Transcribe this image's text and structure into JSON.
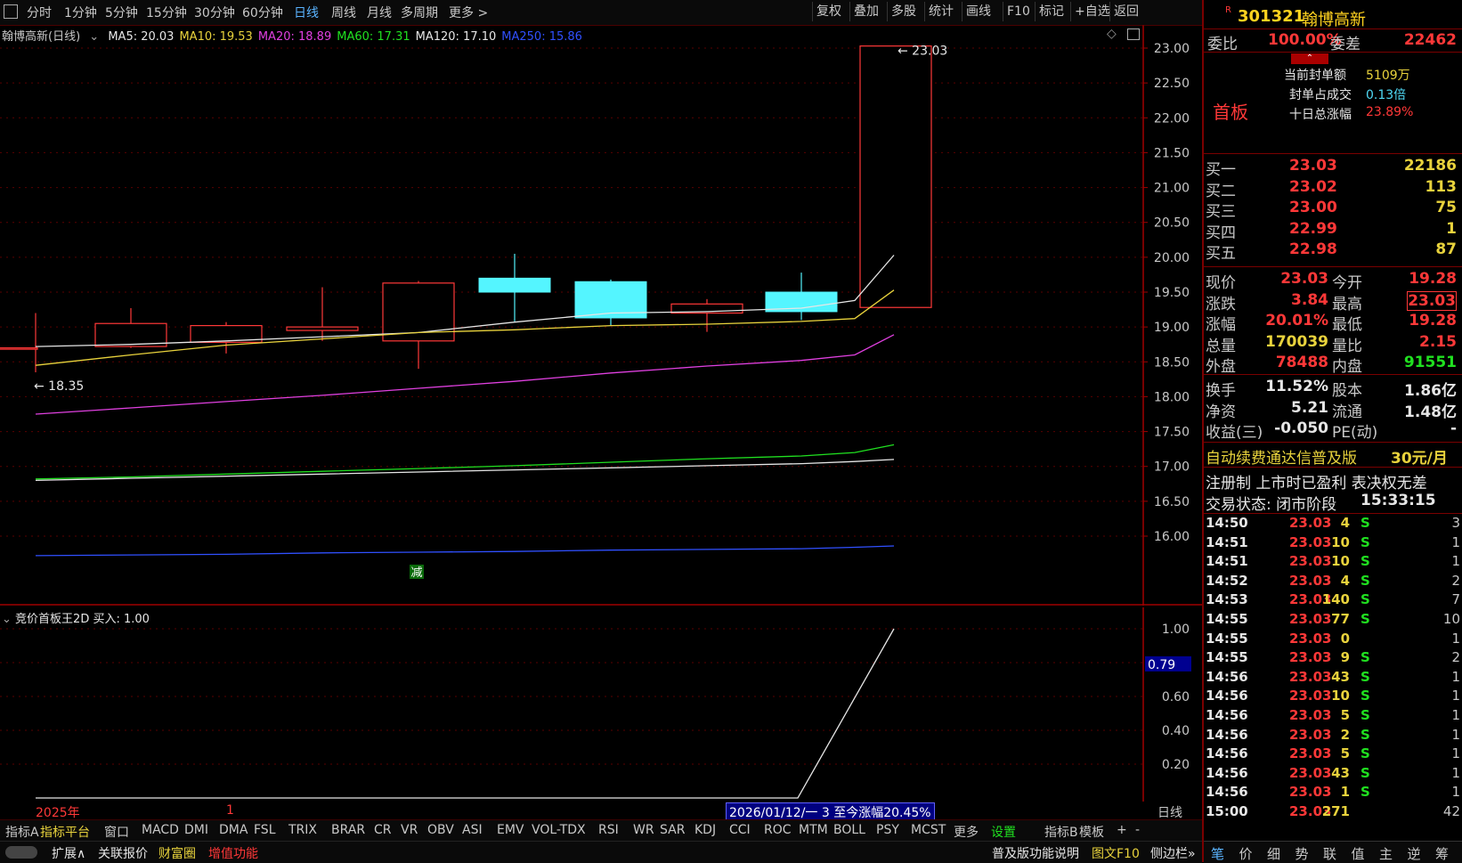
{
  "toolbar": {
    "left_items": [
      "分时",
      "1分钟",
      "5分钟",
      "15分钟",
      "30分钟",
      "60分钟",
      "日线",
      "周线",
      "月线",
      "多周期",
      "更多 >"
    ],
    "active": "日线",
    "right_items": [
      "复权",
      "叠加",
      "多股",
      "统计",
      "画线",
      "F10",
      "标记",
      "+自选",
      "返回"
    ]
  },
  "chart_header": {
    "title": "翰博高新(日线)",
    "ma": [
      {
        "label": "MA5: 20.03",
        "color": "#e6e6e6"
      },
      {
        "label": "MA10: 19.53",
        "color": "#e8d23c"
      },
      {
        "label": "MA20: 18.89",
        "color": "#e040e0"
      },
      {
        "label": "MA60: 17.31",
        "color": "#20e020"
      },
      {
        "label": "MA120: 17.10",
        "color": "#e6e6e6"
      },
      {
        "label": "MA250: 15.86",
        "color": "#3050ff"
      }
    ]
  },
  "chart_data": {
    "type": "candlestick",
    "y_ticks": [
      "23.00",
      "22.50",
      "22.00",
      "21.50",
      "21.00",
      "20.50",
      "20.00",
      "19.50",
      "19.00",
      "18.50",
      "18.00",
      "17.50",
      "17.00",
      "16.50",
      "16.00"
    ],
    "ylim": [
      15.7,
      23.1
    ],
    "candles": [
      {
        "open": 18.7,
        "high": 19.2,
        "low": 18.35,
        "close": 18.7
      },
      {
        "open": 18.72,
        "high": 19.27,
        "low": 18.7,
        "close": 19.05
      },
      {
        "open": 18.78,
        "high": 19.07,
        "low": 18.62,
        "close": 19.02
      },
      {
        "open": 18.95,
        "high": 19.57,
        "low": 18.8,
        "close": 19.0
      },
      {
        "open": 18.8,
        "high": 19.66,
        "low": 18.4,
        "close": 19.63
      },
      {
        "open": 19.7,
        "high": 20.05,
        "low": 19.08,
        "close": 19.5
      },
      {
        "open": 19.65,
        "high": 19.68,
        "low": 19.02,
        "close": 19.13
      },
      {
        "open": 19.2,
        "high": 19.4,
        "low": 18.93,
        "close": 19.33
      },
      {
        "open": 19.5,
        "high": 19.78,
        "low": 19.1,
        "close": 19.22
      },
      {
        "open": 19.28,
        "high": 23.03,
        "low": 19.28,
        "close": 23.03
      }
    ],
    "high_label": "23.03",
    "low_label": "18.35",
    "ma_lines": {
      "MA5": [
        18.72,
        18.75,
        18.8,
        18.86,
        18.92,
        19.07,
        19.2,
        19.22,
        19.27,
        19.38,
        20.03
      ],
      "MA10": [
        18.45,
        18.6,
        18.74,
        18.83,
        18.92,
        18.96,
        19.02,
        19.04,
        19.08,
        19.12,
        19.53
      ],
      "MA20": [
        17.75,
        17.84,
        17.93,
        18.02,
        18.12,
        18.22,
        18.34,
        18.44,
        18.52,
        18.6,
        18.89
      ],
      "MA60": [
        16.82,
        16.85,
        16.89,
        16.93,
        16.97,
        17.01,
        17.06,
        17.11,
        17.15,
        17.2,
        17.31
      ],
      "MA120": [
        16.8,
        16.83,
        16.86,
        16.89,
        16.92,
        16.95,
        16.98,
        17.01,
        17.04,
        17.07,
        17.1
      ],
      "MA250": [
        15.72,
        15.73,
        15.74,
        15.76,
        15.77,
        15.78,
        15.8,
        15.81,
        15.82,
        15.84,
        15.86
      ]
    },
    "reduce_marker": "减"
  },
  "sub_chart": {
    "title": "竞价首板王2D 买入: 1.00",
    "y_ticks": [
      "1.00",
      "0.80",
      "0.60",
      "0.40",
      "0.20"
    ],
    "current_value": "0.79",
    "values": [
      0,
      0,
      0,
      0,
      0,
      0,
      0,
      0,
      0,
      0,
      0,
      0,
      0,
      0,
      0,
      0,
      0,
      0,
      0,
      0,
      0,
      0,
      1.0
    ]
  },
  "time_axis": {
    "year": "2025年",
    "month": "1",
    "range_text": "2026/01/12/一 3 至今涨幅20.45%",
    "period": "日线"
  },
  "indicator_bar": [
    "指标A",
    "指标平台",
    "窗口",
    "MACD",
    "DMI",
    "DMA",
    "FSL",
    "TRIX",
    "BRAR",
    "CR",
    "VR",
    "OBV",
    "ASI",
    "EMV",
    "VOL-TDX",
    "RSI",
    "WR",
    "SAR",
    "KDJ",
    "CCI",
    "ROC",
    "MTM",
    "BOLL",
    "PSY",
    "MCST",
    "更多",
    "设置",
    "指标B",
    "模板",
    "+",
    "-"
  ],
  "status_bar": {
    "expand": "扩展∧",
    "related": "关联报价",
    "wealth": "财富圈",
    "value_added": "增值功能",
    "help": "普及版功能说明",
    "f10": "图文F10",
    "sidebar": "侧边栏»"
  },
  "quote": {
    "code": "301321",
    "name": "翰博高新",
    "weibi_label": "委比",
    "weibi": "100.00%",
    "weicha_label": "委差",
    "weicha": "22462",
    "board": "首板",
    "seal_amount_label": "当前封单额",
    "seal_amount": "5109万",
    "seal_ratio_label": "封单占成交",
    "seal_ratio": "0.13倍",
    "ten_day_label": "十日总涨幅",
    "ten_day": "23.89%",
    "bids": [
      {
        "label": "买一",
        "price": "23.03",
        "vol": "22186"
      },
      {
        "label": "买二",
        "price": "23.02",
        "vol": "113"
      },
      {
        "label": "买三",
        "price": "23.00",
        "vol": "75"
      },
      {
        "label": "买四",
        "price": "22.99",
        "vol": "1"
      },
      {
        "label": "买五",
        "price": "22.98",
        "vol": "87"
      }
    ],
    "stats": [
      {
        "l1": "现价",
        "v1": "23.03",
        "l2": "今开",
        "v2": "19.28"
      },
      {
        "l1": "涨跌",
        "v1": "3.84",
        "l2": "最高",
        "v2": "23.03"
      },
      {
        "l1": "涨幅",
        "v1": "20.01%",
        "l2": "最低",
        "v2": "19.28"
      },
      {
        "l1": "总量",
        "v1": "170039",
        "l2": "量比",
        "v2": "2.15"
      },
      {
        "l1": "外盘",
        "v1": "78488",
        "l2": "内盘",
        "v2": "91551"
      }
    ],
    "fund": [
      {
        "l1": "换手",
        "v1": "11.52%",
        "l2": "股本",
        "v2": "1.86亿"
      },
      {
        "l1": "净资",
        "v1": "5.21",
        "l2": "流通",
        "v2": "1.48亿"
      },
      {
        "l1": "收益(三)",
        "v1": "-0.050",
        "l2": "PE(动)",
        "v2": "-"
      }
    ],
    "promo": "自动续费通达信普及版",
    "promo_price": "30元/月",
    "reg_info": "注册制 上市时已盈利 表决权无差",
    "trade_state_label": "交易状态: 闭市阶段",
    "trade_state_time": "15:33:15",
    "trades": [
      {
        "t": "14:50",
        "p": "23.03",
        "v": "4",
        "s": "S",
        "n": "3"
      },
      {
        "t": "14:51",
        "p": "23.03",
        "v": "10",
        "s": "S",
        "n": "1"
      },
      {
        "t": "14:51",
        "p": "23.03",
        "v": "10",
        "s": "S",
        "n": "1"
      },
      {
        "t": "14:52",
        "p": "23.03",
        "v": "4",
        "s": "S",
        "n": "2"
      },
      {
        "t": "14:53",
        "p": "23.03",
        "v": "140",
        "s": "S",
        "n": "7"
      },
      {
        "t": "14:55",
        "p": "23.03",
        "v": "77",
        "s": "S",
        "n": "10"
      },
      {
        "t": "14:55",
        "p": "23.03",
        "v": "0",
        "s": "",
        "n": "1"
      },
      {
        "t": "14:55",
        "p": "23.03",
        "v": "9",
        "s": "S",
        "n": "2"
      },
      {
        "t": "14:56",
        "p": "23.03",
        "v": "43",
        "s": "S",
        "n": "1"
      },
      {
        "t": "14:56",
        "p": "23.03",
        "v": "10",
        "s": "S",
        "n": "1"
      },
      {
        "t": "14:56",
        "p": "23.03",
        "v": "5",
        "s": "S",
        "n": "1"
      },
      {
        "t": "14:56",
        "p": "23.03",
        "v": "2",
        "s": "S",
        "n": "1"
      },
      {
        "t": "14:56",
        "p": "23.03",
        "v": "5",
        "s": "S",
        "n": "1"
      },
      {
        "t": "14:56",
        "p": "23.03",
        "v": "43",
        "s": "S",
        "n": "1"
      },
      {
        "t": "14:56",
        "p": "23.03",
        "v": "1",
        "s": "S",
        "n": "1"
      },
      {
        "t": "15:00",
        "p": "23.03",
        "v": "271",
        "s": "",
        "n": "42"
      }
    ],
    "bottom_tabs": [
      "笔",
      "价",
      "细",
      "势",
      "联",
      "值",
      "主",
      "逆",
      "筹"
    ]
  },
  "colors": {
    "up": "#ff3838",
    "down": "#54f5ff",
    "grid": "#7a0000"
  }
}
